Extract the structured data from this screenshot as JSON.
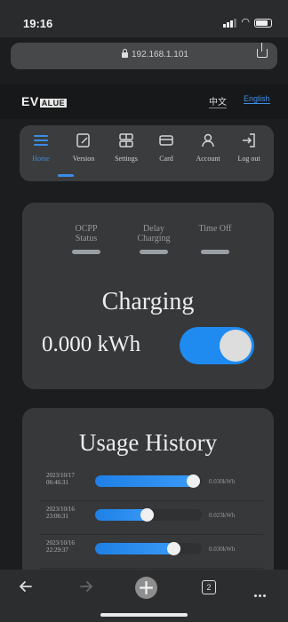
{
  "status_bar": {
    "time": "19:16"
  },
  "browser": {
    "url": "192.168.1.101",
    "icons": {
      "lock": "lock-icon",
      "share": "share-icon"
    },
    "toolbar_icons": [
      "back-icon",
      "forward-icon",
      "new-tab-icon",
      "tabs-icon",
      "more-icon"
    ],
    "tab_count": "2"
  },
  "header": {
    "logo": {
      "main": "EV",
      "tail": "ALUE"
    },
    "lang_zh": "中文",
    "lang_en": "English"
  },
  "nav": {
    "active": "Home",
    "items": [
      {
        "label": "Home",
        "icon": "menu-icon"
      },
      {
        "label": "Version",
        "icon": "edit-icon"
      },
      {
        "label": "Settings",
        "icon": "settings-icon"
      },
      {
        "label": "Card",
        "icon": "card-icon"
      },
      {
        "label": "Account",
        "icon": "user-icon"
      },
      {
        "label": "Log out",
        "icon": "logout-icon"
      }
    ]
  },
  "status": {
    "indicators": [
      {
        "label_line1": "OCPP",
        "label_line2": "Status"
      },
      {
        "label_line1": "Delay",
        "label_line2": "Charging"
      },
      {
        "label_line1": "Time Off",
        "label_line2": ""
      }
    ],
    "charging_label": "Charging",
    "energy": "0.000 kWh",
    "toggle_on": true
  },
  "history": {
    "title": "Usage History",
    "entries": [
      {
        "date_line1": "2023/10/17",
        "date_line2": "06:46:31",
        "value": "0.030kWh",
        "level": 0.98
      },
      {
        "date_line1": "2023/10/16",
        "date_line2": "23:06:31",
        "value": "0.023kWh",
        "level": 0.55
      },
      {
        "date_line1": "2023/10/16",
        "date_line2": "22:29:37",
        "value": "0.030kWh",
        "level": 0.8
      }
    ]
  },
  "colors": {
    "accent": "#1f8bf0",
    "card": "#36383a",
    "background": "#1c1d1f"
  }
}
